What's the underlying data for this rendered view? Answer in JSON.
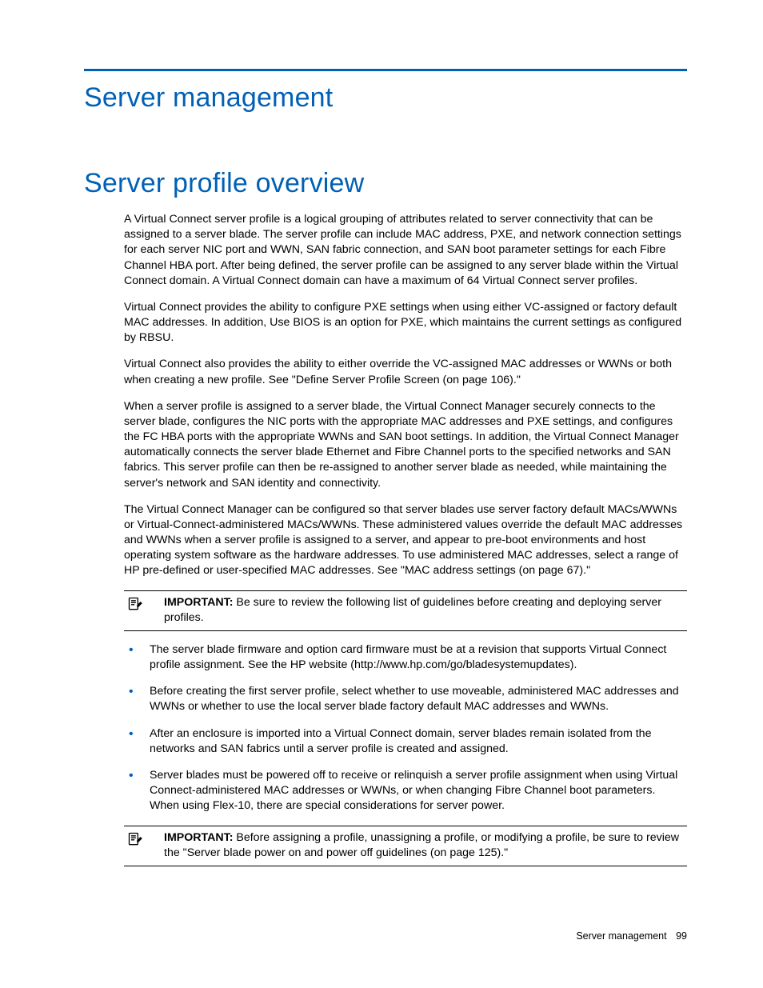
{
  "chapter_title": "Server management",
  "section_title": "Server profile overview",
  "paragraphs": {
    "p1": "A Virtual Connect server profile is a logical grouping of attributes related to server connectivity that can be assigned to a server blade. The server profile can include MAC address, PXE, and network connection settings for each server NIC port and WWN, SAN fabric connection, and SAN boot parameter settings for each Fibre Channel HBA port. After being defined, the server profile can be assigned to any server blade within the Virtual Connect domain. A Virtual Connect domain can have a maximum of 64 Virtual Connect server profiles.",
    "p2": "Virtual Connect provides the ability to configure PXE settings when using either VC-assigned or factory default MAC addresses. In addition, Use BIOS is an option for PXE, which maintains the current settings as configured by RBSU.",
    "p3": "Virtual Connect also provides the ability to either override the VC-assigned MAC addresses or WWNs or both when creating a new profile. See \"Define Server Profile Screen (on page 106).\"",
    "p4": "When a server profile is assigned to a server blade, the Virtual Connect Manager securely connects to the server blade, configures the NIC ports with the appropriate MAC addresses and PXE settings, and configures the FC HBA ports with the appropriate WWNs and SAN boot settings. In addition, the Virtual Connect Manager automatically connects the server blade Ethernet and Fibre Channel ports to the specified networks and SAN fabrics. This server profile can then be re-assigned to another server blade as needed, while maintaining the server's network and SAN identity and connectivity.",
    "p5": "The Virtual Connect Manager can be configured so that server blades use server factory default MACs/WWNs or Virtual-Connect-administered MACs/WWNs. These administered values override the default MAC addresses and WWNs when a server profile is assigned to a server, and appear to pre-boot environments and host operating system software as the hardware addresses. To use administered MAC addresses, select a range of HP pre-defined or user-specified MAC addresses. See \"MAC address settings (on page 67).\""
  },
  "callouts": {
    "label": "IMPORTANT:",
    "c1": "Be sure to review the following list of guidelines before creating and deploying server profiles.",
    "c2": "Before assigning a profile, unassigning a profile, or modifying a profile, be sure to review the \"Server blade power on and power off guidelines (on page 125).\""
  },
  "bullets": {
    "b1": "The server blade firmware and option card firmware must be at a revision that supports Virtual Connect profile assignment. See the HP website (http://www.hp.com/go/bladesystemupdates).",
    "b2": "Before creating the first server profile, select whether to use moveable, administered MAC addresses and WWNs or whether to use the local server blade factory default MAC addresses and WWNs.",
    "b3": "After an enclosure is imported into a Virtual Connect domain, server blades remain isolated from the networks and SAN fabrics until a server profile is created and assigned.",
    "b4": "Server blades must be powered off to receive or relinquish a server profile assignment when using Virtual Connect-administered MAC addresses or WWNs, or when changing Fibre Channel boot parameters. When using Flex-10, there are special considerations for server power."
  },
  "footer": {
    "section": "Server management",
    "page": "99"
  }
}
